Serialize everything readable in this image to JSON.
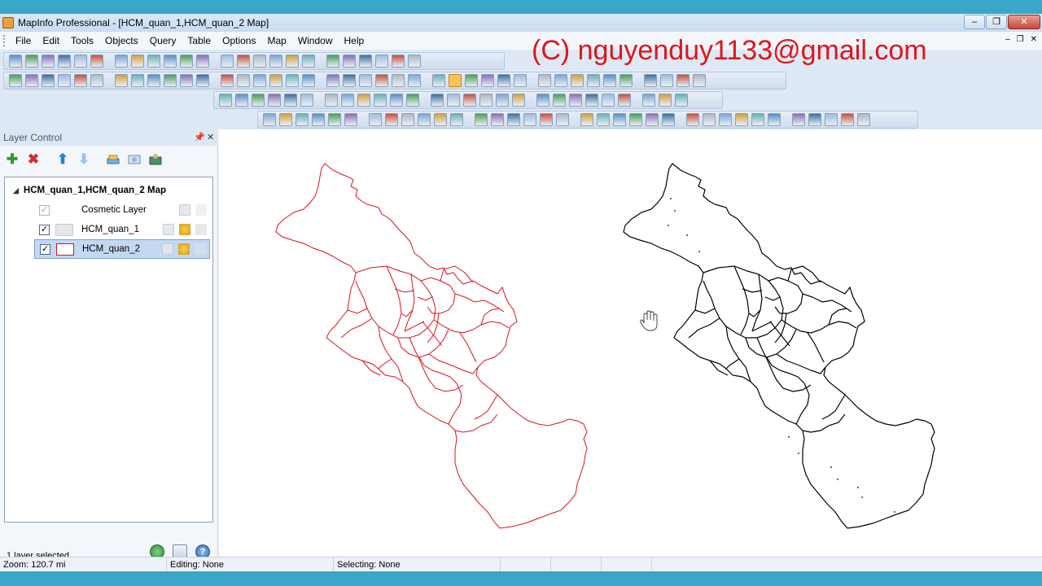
{
  "window": {
    "title": "MapInfo Professional - [HCM_quan_1,HCM_quan_2 Map]",
    "controls": [
      "–",
      "❐",
      "✕"
    ]
  },
  "menu": {
    "items": [
      "File",
      "Edit",
      "Tools",
      "Objects",
      "Query",
      "Table",
      "Options",
      "Map",
      "Window",
      "Help"
    ],
    "mdi_controls": [
      "–",
      "❐",
      "✕"
    ]
  },
  "watermark": "(C) nguyenduy1133@gmail.com",
  "layer_control": {
    "title": "Layer Control",
    "header_controls": [
      "📌",
      "✕"
    ],
    "map_name": "HCM_quan_1,HCM_quan_2 Map",
    "layers": [
      {
        "name": "Cosmetic Layer",
        "checked": true,
        "selected": false
      },
      {
        "name": "HCM_quan_1",
        "checked": true,
        "selected": false
      },
      {
        "name": "HCM_quan_2",
        "checked": true,
        "selected": true
      }
    ],
    "status": "1 layer selected"
  },
  "statusbar": {
    "zoom": "Zoom: 120.7 mi",
    "editing": "Editing: None",
    "selecting": "Selecting: None"
  },
  "colors": {
    "accent": "#3aa7c9",
    "left_map": "#d9141c",
    "right_map": "#000000"
  }
}
